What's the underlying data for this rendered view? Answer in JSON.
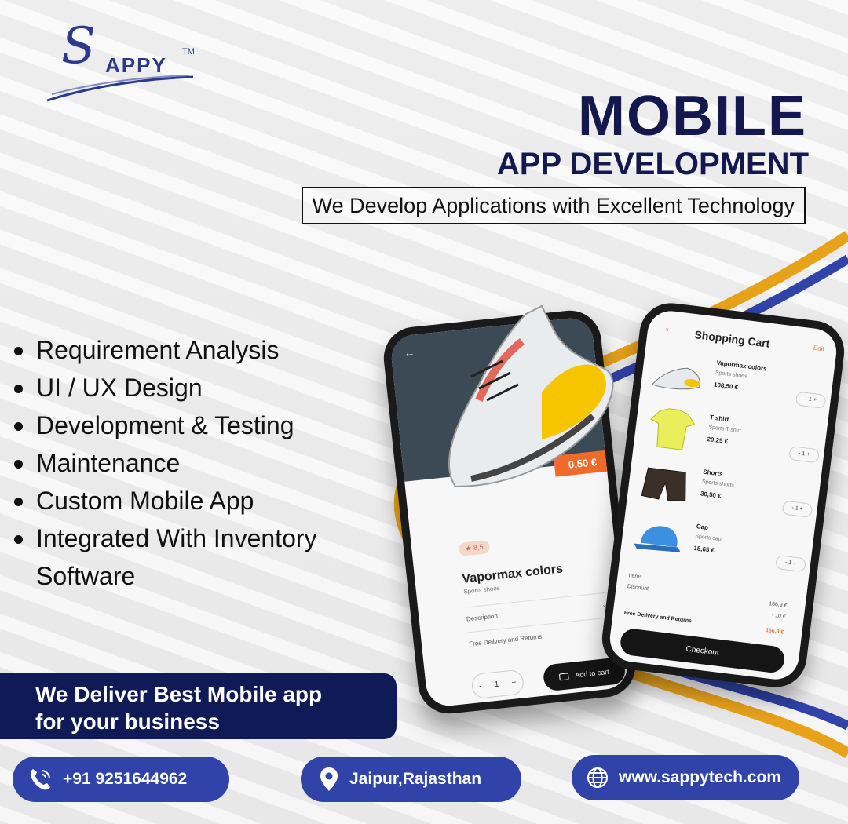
{
  "brand": {
    "logo_letter": "S",
    "logo_word": "APPY",
    "tm": "TM"
  },
  "headline": {
    "line1": "MOBILE",
    "line2": "APP DEVELOPMENT",
    "tagline": "We Develop Applications with Excellent Technology"
  },
  "features": [
    "Requirement Analysis",
    "UI / UX Design",
    "Development & Testing",
    "Maintenance",
    "Custom Mobile App",
    "Integrated With Inventory Software"
  ],
  "banner": {
    "line1": "We Deliver Best Mobile app",
    "line2": "for your business"
  },
  "contact": {
    "phone": "+91 9251644962",
    "location": "Jaipur,Rajasthan",
    "website": "www.sappytech.com"
  },
  "product_screen": {
    "back": "←",
    "price": "0,50 €",
    "rating": "★ 8,5",
    "name": "Vapormax colors",
    "subtitle": "Sports shoes",
    "description": "Description",
    "delivery": "Free Delivery and Returns",
    "qty_minus": "-",
    "qty": "1",
    "qty_plus": "+",
    "add_to_cart": "Add to cart"
  },
  "cart_screen": {
    "close": "×",
    "title": "Shopping Cart",
    "edit": "Edit",
    "items": [
      {
        "name": "Vapormax colors",
        "sub": "Sports shoes",
        "price": "108,50 €",
        "qty": "- 1 +"
      },
      {
        "name": "T shirt",
        "sub": "Sports T shirt",
        "price": "20,25 €",
        "qty": "- 1 +"
      },
      {
        "name": "Shorts",
        "sub": "Sports shorts",
        "price": "30,50 €",
        "qty": "- 1 +"
      },
      {
        "name": "Cap",
        "sub": "Sports cap",
        "price": "15,65 €",
        "qty": "- 1 +"
      }
    ],
    "items_label": "Items",
    "items_value": "166,9 €",
    "discount_label": "Discount",
    "discount_value": "- 10 €",
    "delivery_label": "Free Delivery and Returns",
    "total": "156,9 €",
    "checkout": "Checkout"
  },
  "colors": {
    "navy": "#13194f",
    "blue": "#2f43a9",
    "orange": "#e8a21a"
  }
}
